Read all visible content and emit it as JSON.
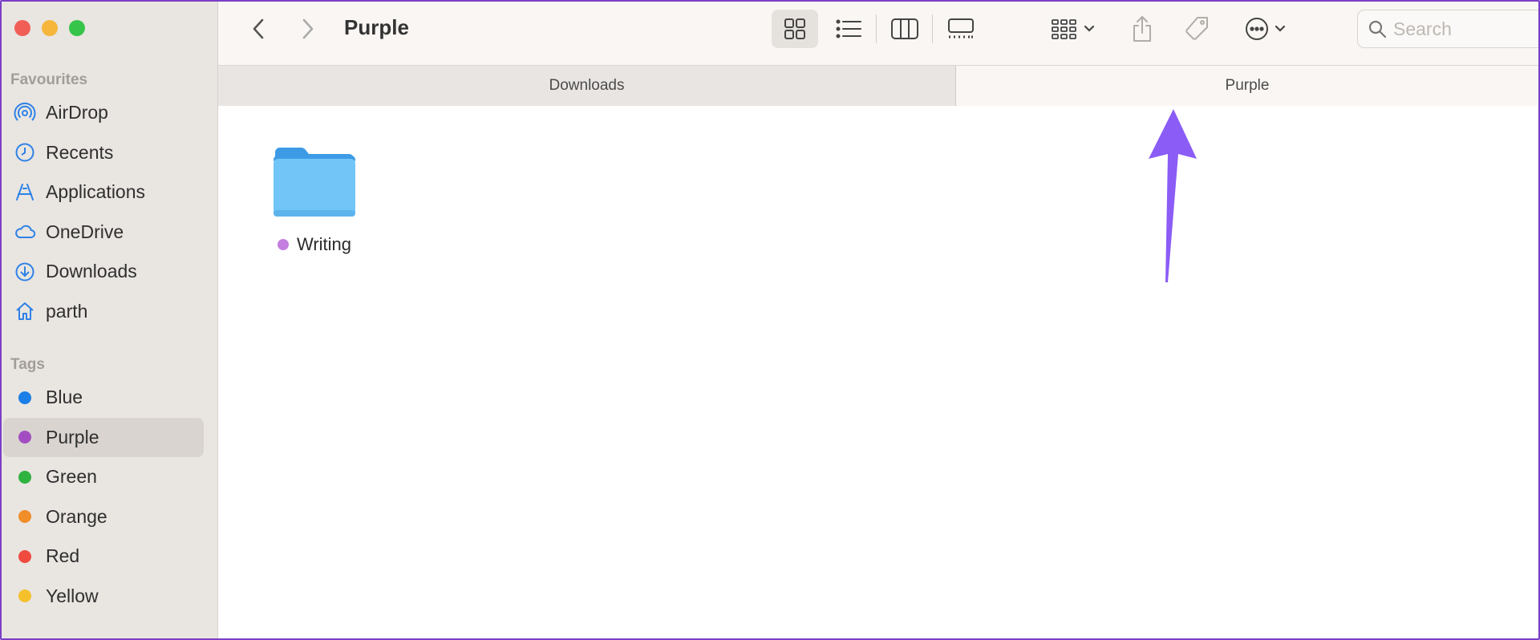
{
  "window": {
    "title": "Purple"
  },
  "sidebar": {
    "favourites_title": "Favourites",
    "favourites": [
      {
        "label": "AirDrop",
        "icon": "airdrop-icon"
      },
      {
        "label": "Recents",
        "icon": "clock-icon"
      },
      {
        "label": "Applications",
        "icon": "applications-icon"
      },
      {
        "label": "OneDrive",
        "icon": "cloud-icon"
      },
      {
        "label": "Downloads",
        "icon": "download-icon"
      },
      {
        "label": "parth",
        "icon": "home-icon"
      }
    ],
    "tags_title": "Tags",
    "tags": [
      {
        "label": "Blue",
        "color": "#1a7fe6"
      },
      {
        "label": "Purple",
        "color": "#a24ec2",
        "selected": true
      },
      {
        "label": "Green",
        "color": "#2eb240"
      },
      {
        "label": "Orange",
        "color": "#f08e2a"
      },
      {
        "label": "Red",
        "color": "#ef4b3f"
      },
      {
        "label": "Yellow",
        "color": "#f4c12c"
      }
    ]
  },
  "toolbar": {
    "search_placeholder": "Search"
  },
  "tabs": [
    {
      "label": "Downloads",
      "active": false
    },
    {
      "label": "Purple",
      "active": true
    }
  ],
  "items": [
    {
      "name": "Writing",
      "tag_color": "#c47fe0",
      "icon": "folder-icon"
    }
  ],
  "colors": {
    "accent": "#2e82e6",
    "arrow": "#8b5cf6",
    "border": "#7b3fc8"
  }
}
